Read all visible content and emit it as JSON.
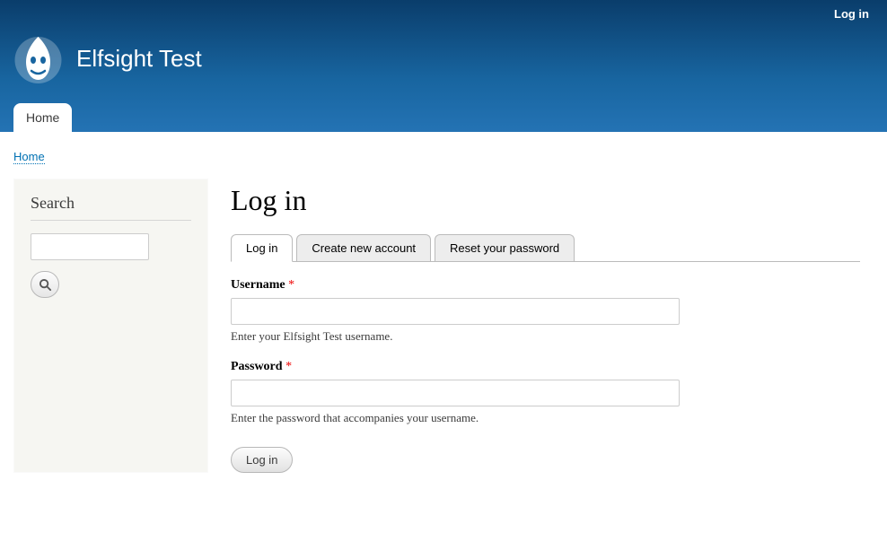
{
  "topbar": {
    "login_link": "Log in"
  },
  "site": {
    "name": "Elfsight Test"
  },
  "nav": {
    "home": "Home"
  },
  "breadcrumb": {
    "home": "Home"
  },
  "sidebar": {
    "search_title": "Search",
    "search_value": ""
  },
  "page": {
    "title": "Log in"
  },
  "tabs": {
    "login": "Log in",
    "create": "Create new account",
    "reset": "Reset your password"
  },
  "form": {
    "username_label": "Username",
    "username_value": "",
    "username_desc": "Enter your Elfsight Test username.",
    "password_label": "Password",
    "password_value": "",
    "password_desc": "Enter the password that accompanies your username.",
    "required_mark": "*",
    "submit": "Log in"
  }
}
